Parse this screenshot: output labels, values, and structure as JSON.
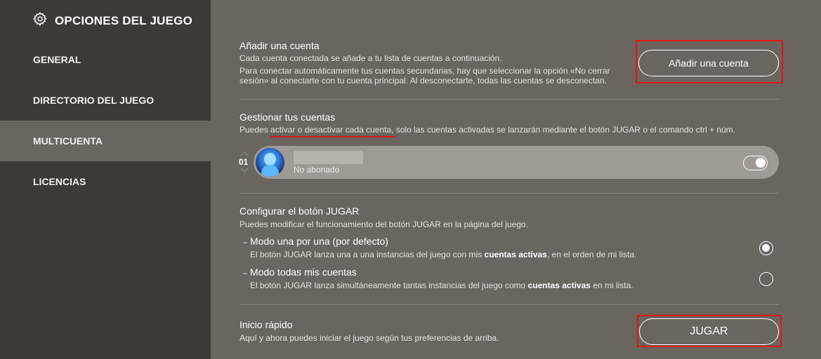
{
  "sidebar": {
    "title": "OPCIONES DEL JUEGO",
    "items": [
      {
        "label": "GENERAL"
      },
      {
        "label": "DIRECTORIO DEL JUEGO"
      },
      {
        "label": "MULTICUENTA",
        "active": true
      },
      {
        "label": "LICENCIAS"
      }
    ]
  },
  "add_account": {
    "title": "Añadir una cuenta",
    "desc1": "Cada cuenta conectada se añade a tu lista de cuentas a continuación.",
    "desc2": "Para conectar automáticamente tus cuentas secundarias, hay que seleccionar la opción «No cerrar",
    "desc3": "sesión» al conectarte con tu cuenta principal. Al desconectarte, todas las cuentas se desconectan.",
    "button_label": "Añadir una cuenta"
  },
  "manage": {
    "title": "Gestionar tus cuentas",
    "desc_pre": "Puedes ",
    "desc_link": "activar o desactivar cada cuenta",
    "desc_post": ", solo las cuentas activadas se lanzarán mediante el botón JUGAR o el comando ctrl + núm.",
    "account": {
      "index": "01",
      "status": "No abonado",
      "enabled": true
    }
  },
  "play_config": {
    "title": "Configurar el botón JUGAR",
    "desc": "Puedes modificar el funcionamiento del botón JUGAR en la página del juego.",
    "options": [
      {
        "title": "Modo una por una (por defecto)",
        "desc_pre": "El botón JUGAR lanza una a una instancias del juego con mis ",
        "desc_bold": "cuentas activas",
        "desc_post": ", en el orden de mi lista.",
        "selected": true
      },
      {
        "title": "Modo todas mis cuentas",
        "desc_pre": "El botón JUGAR lanza simultáneamente tantas instancias del juego como ",
        "desc_bold": "cuentas activas",
        "desc_post": " en mi lista.",
        "selected": false
      }
    ]
  },
  "quick_start": {
    "title": "Inicio rápido",
    "desc": "Aquí y ahora puedes iniciar el juego según tus preferencias de arriba.",
    "button_label": "JUGAR"
  },
  "colors": {
    "sidebar_bg": "#3d3a36",
    "main_bg": "#6a655f",
    "highlight_red": "#e0161a"
  },
  "icons": {
    "header": "gear-icon",
    "toggle": "toggle-switch-icon"
  }
}
